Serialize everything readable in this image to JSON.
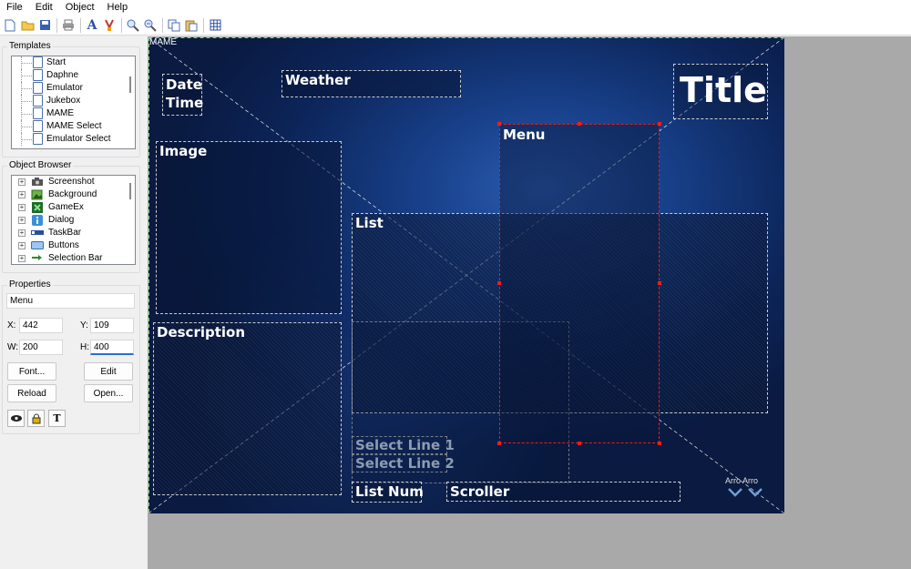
{
  "menubar": {
    "items": [
      "File",
      "Edit",
      "Object",
      "Help"
    ]
  },
  "left": {
    "templates": {
      "title": "Templates",
      "items": [
        "Start",
        "Daphne",
        "Emulator",
        "Jukebox",
        "MAME",
        "MAME Select",
        "Emulator Select"
      ]
    },
    "object_browser": {
      "title": "Object Browser",
      "items": [
        {
          "label": "Screenshot",
          "icon": "camera-icon"
        },
        {
          "label": "Background",
          "icon": "background-icon"
        },
        {
          "label": "GameEx",
          "icon": "gameex-icon"
        },
        {
          "label": "Dialog",
          "icon": "dialog-icon"
        },
        {
          "label": "TaskBar",
          "icon": "taskbar-icon"
        },
        {
          "label": "Buttons",
          "icon": "buttons-icon"
        },
        {
          "label": "Selection Bar",
          "icon": "selection-bar-icon"
        }
      ]
    },
    "properties": {
      "title": "Properties",
      "name": "Menu",
      "x_label": "X:",
      "x": "442",
      "y_label": "Y:",
      "y": "109",
      "w_label": "W:",
      "w": "200",
      "h_label": "H:",
      "h": "400",
      "font_button": "Font...",
      "edit_button": "Edit",
      "reload_button": "Reload",
      "open_button": "Open..."
    }
  },
  "canvas": {
    "label": "MAME",
    "objects": {
      "date": "Date",
      "time": "Time",
      "weather": "Weather",
      "title": "Title",
      "menu": "Menu",
      "image": "Image",
      "list": "List",
      "description": "Description",
      "select_line_1": "Select Line 1",
      "select_line_2": "Select Line 2",
      "list_num": "List Num",
      "scroller": "Scroller",
      "arrows": "Arro Arro"
    }
  }
}
